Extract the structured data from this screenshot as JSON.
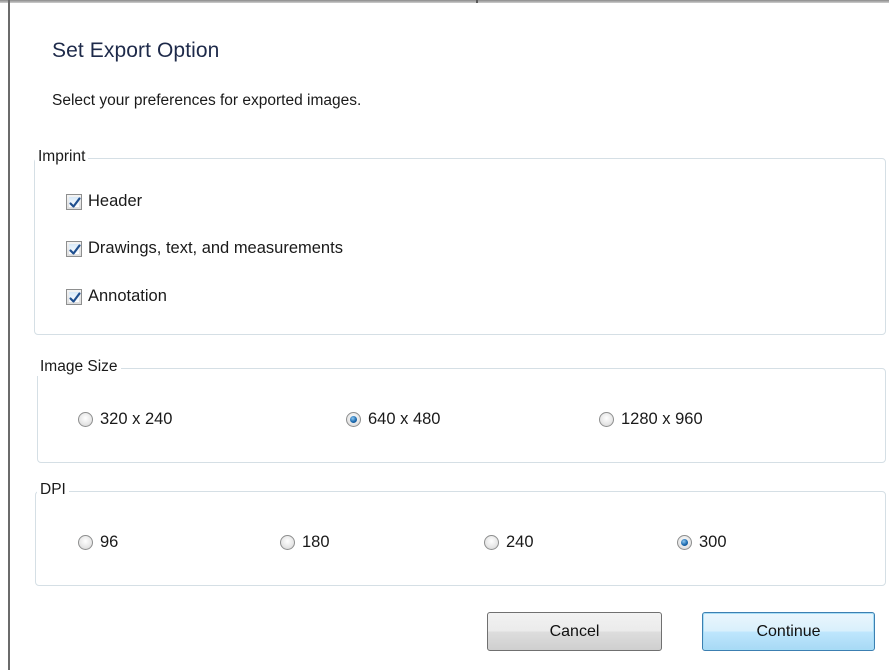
{
  "dialog": {
    "title": "Set Export Option",
    "subtitle": "Select your preferences for exported images."
  },
  "imprint": {
    "label": "Imprint",
    "options": [
      {
        "label": "Header",
        "checked": true
      },
      {
        "label": "Drawings, text, and measurements",
        "checked": true
      },
      {
        "label": "Annotation",
        "checked": true
      }
    ]
  },
  "image_size": {
    "label": "Image Size",
    "options": [
      "320 x 240",
      "640 x 480",
      "1280 x 960"
    ],
    "selected": "640 x 480"
  },
  "dpi": {
    "label": "DPI",
    "options": [
      "96",
      "180",
      "240",
      "300"
    ],
    "selected": "300"
  },
  "buttons": {
    "cancel": "Cancel",
    "continue": "Continue"
  },
  "colors": {
    "title_text": "#1e2a4a",
    "group_border": "#d5dfe5",
    "default_button_border": "#3c7fb1",
    "radio_selected": "#1c6bb0",
    "check_mark": "#1f4f8f"
  }
}
